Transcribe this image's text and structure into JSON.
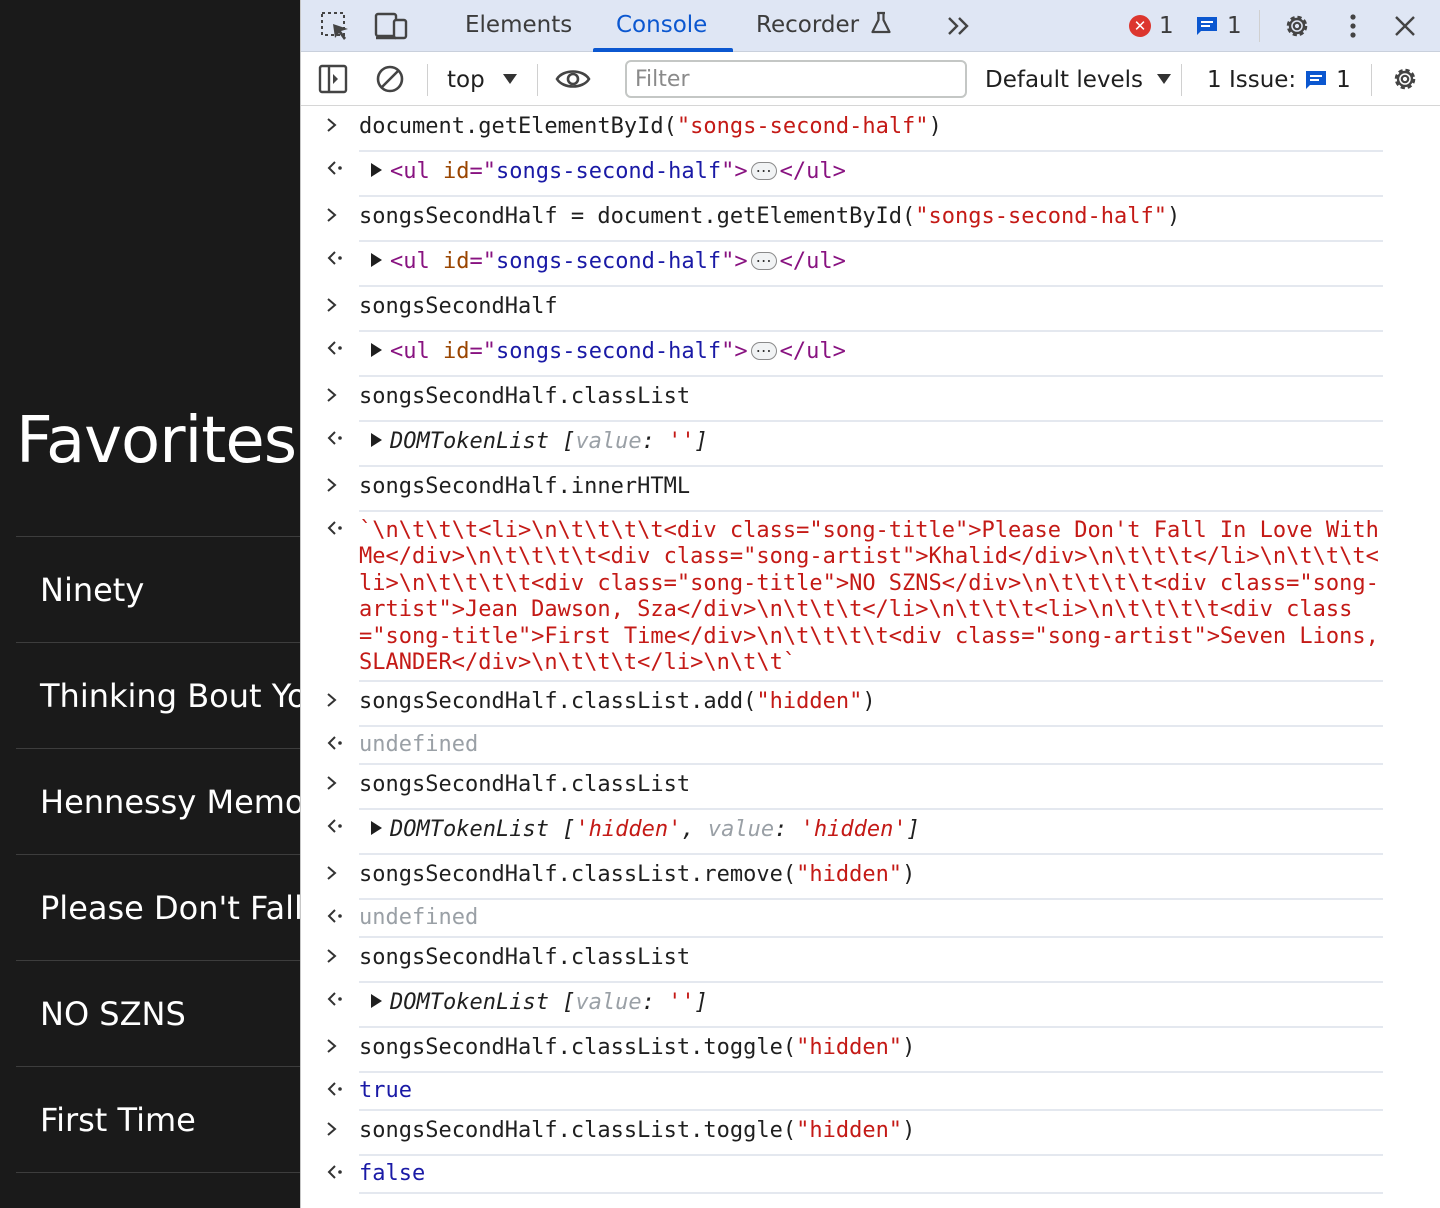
{
  "page": {
    "heading": "Favorites",
    "songs": [
      "Ninety",
      "Thinking Bout You",
      "Hennessy Memories",
      "Please Don't Fall In Love With Me",
      "NO SZNS",
      "First Time"
    ]
  },
  "devtools": {
    "tabs": {
      "elements": "Elements",
      "console": "Console",
      "recorder": "Recorder"
    },
    "counters": {
      "errors": "1",
      "messages": "1"
    },
    "toolbar": {
      "context": "top",
      "filter_placeholder": "Filter",
      "levels": "Default levels",
      "issues_label": "1 Issue:",
      "issues_count": "1"
    },
    "colors": {
      "accent": "#0b57d0",
      "error": "#dc362e",
      "string": "#c41a16"
    }
  },
  "console": {
    "entries": [
      {
        "type": "input",
        "text": "document.getElementById(\"songs-second-half\")"
      },
      {
        "type": "element",
        "text": "<ul id=\"songs-second-half\">…</ul>"
      },
      {
        "type": "input",
        "text": "songsSecondHalf = document.getElementById(\"songs-second-half\")"
      },
      {
        "type": "element",
        "text": "<ul id=\"songs-second-half\">…</ul>"
      },
      {
        "type": "input",
        "text": "songsSecondHalf"
      },
      {
        "type": "element",
        "text": "<ul id=\"songs-second-half\">…</ul>"
      },
      {
        "type": "input",
        "text": "songsSecondHalf.classList"
      },
      {
        "type": "object",
        "text": "DOMTokenList [value: '']"
      },
      {
        "type": "input",
        "text": "songsSecondHalf.innerHTML"
      },
      {
        "type": "string",
        "text": "`\\n\\t\\t\\t<li>\\n\\t\\t\\t\\t<div class=\"song-title\">Please Don't Fall In Love With Me</div>\\n\\t\\t\\t\\t<div class=\"song-artist\">Khalid</div>\\n\\t\\t\\t</li>\\n\\t\\t\\t<li>\\n\\t\\t\\t\\t<div class=\"song-title\">NO SZNS</div>\\n\\t\\t\\t\\t<div class=\"song-artist\">Jean Dawson, Sza</div>\\n\\t\\t\\t</li>\\n\\t\\t\\t<li>\\n\\t\\t\\t\\t<div class=\"song-title\">First Time</div>\\n\\t\\t\\t\\t<div class=\"song-artist\">Seven Lions, SLANDER</div>\\n\\t\\t\\t</li>\\n\\t\\t`"
      },
      {
        "type": "input",
        "text": "songsSecondHalf.classList.add(\"hidden\")"
      },
      {
        "type": "undefined",
        "text": "undefined"
      },
      {
        "type": "input",
        "text": "songsSecondHalf.classList"
      },
      {
        "type": "object",
        "text": "DOMTokenList ['hidden', value: 'hidden']"
      },
      {
        "type": "input",
        "text": "songsSecondHalf.classList.remove(\"hidden\")"
      },
      {
        "type": "undefined",
        "text": "undefined"
      },
      {
        "type": "input",
        "text": "songsSecondHalf.classList"
      },
      {
        "type": "object",
        "text": "DOMTokenList [value: '']"
      },
      {
        "type": "input",
        "text": "songsSecondHalf.classList.toggle(\"hidden\")"
      },
      {
        "type": "boolean",
        "text": "true"
      },
      {
        "type": "input",
        "text": "songsSecondHalf.classList.toggle(\"hidden\")"
      },
      {
        "type": "boolean",
        "text": "false"
      }
    ]
  }
}
